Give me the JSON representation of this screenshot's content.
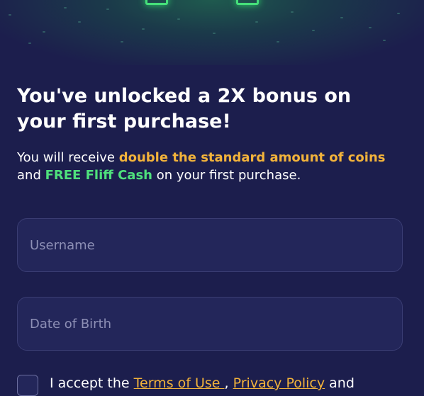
{
  "colors": {
    "background": "#1c1e4d",
    "field_background": "#23265a",
    "accent_gold": "#f2b33b",
    "accent_green": "#4fe07c",
    "placeholder": "#8d8fb5"
  },
  "promo": {
    "headline": "You've unlocked a 2X bonus on your first purchase!",
    "sub_prefix": "You will receive ",
    "sub_highlight": "double the standard amount of coins",
    "sub_mid": " and ",
    "sub_green": "FREE Fliff Cash",
    "sub_suffix": " on your first purchase."
  },
  "form": {
    "username_placeholder": "Username",
    "dob_placeholder": "Date of Birth"
  },
  "terms": {
    "prefix": "I accept the ",
    "terms_link": "Terms of Use ",
    "comma": ", ",
    "privacy_link": "Privacy Policy",
    "and": " and"
  }
}
